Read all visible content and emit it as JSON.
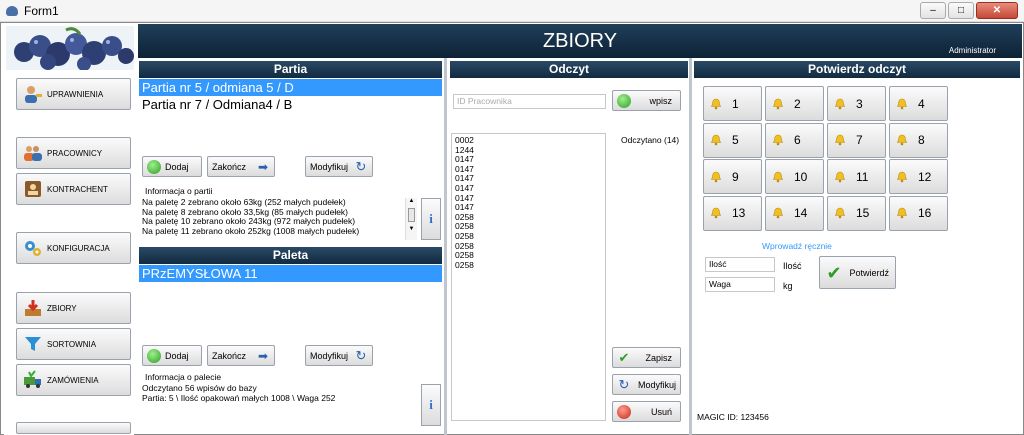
{
  "window": {
    "title": "Form1"
  },
  "header": {
    "title": "ZBIORY",
    "user": "Administrator"
  },
  "sidebar": {
    "items": [
      {
        "label": "UPRAWNIENIA",
        "icon": "user-key-icon"
      },
      {
        "label": "PRACOWNICY",
        "icon": "users-icon"
      },
      {
        "label": "KONTRACHENT",
        "icon": "contact-card-icon"
      },
      {
        "label": "KONFIGURACJA",
        "icon": "gears-icon"
      },
      {
        "label": "ZBIORY",
        "icon": "inbox-tray-icon"
      },
      {
        "label": "SORTOWNIA",
        "icon": "funnel-icon"
      },
      {
        "label": "ZAMÓWIENIA",
        "icon": "truck-icon"
      }
    ]
  },
  "partia": {
    "title": "Partia",
    "items": [
      "Partia nr 5 / odmiana 5 / D",
      "Partia nr 7 / Odmiana4 / B"
    ],
    "buttons": {
      "add": "Dodaj",
      "finish": "Zakończ",
      "modify": "Modyfikuj"
    },
    "info_label": "Informacja o partii",
    "info_lines": [
      "Na paletę 2 zebrano około 63kg (252 małych pudełek)",
      "Na paletę 8 zebrano około 33,5kg (85 małych pudełek)",
      "Na paletę 10 zebrano około 243kg (972 małych pudełek)",
      "Na paletę 11 zebrano około 252kg (1008 małych pudełek)"
    ],
    "info_button": "i"
  },
  "paleta": {
    "title": "Paleta",
    "items": [
      "PRzEMYSŁOWA 11"
    ],
    "buttons": {
      "add": "Dodaj",
      "finish": "Zakończ",
      "modify": "Modyfikuj"
    },
    "info_label": "Informacja o palecie",
    "info_lines": [
      "Odczytano 56 wpisów do bazy",
      "Partia: 5 \\ Ilość opakowań małych 1008 \\ Waga 252"
    ],
    "info_button": "i"
  },
  "odczyt": {
    "title": "Odczyt",
    "employee_placeholder": "ID Pracownika",
    "add_button": "wpisz",
    "count_label": "Odczytano (14)",
    "readings": [
      "0002",
      "1244",
      "0147",
      "0147",
      "0147",
      "0147",
      "0147",
      "0147",
      "0258",
      "0258",
      "0258",
      "0258",
      "0258",
      "0258"
    ],
    "buttons": {
      "save": "Zapisz",
      "modify": "Modyfikuj",
      "delete": "Usuń"
    }
  },
  "potwierdz": {
    "title": "Potwierdz odczyt",
    "keys": [
      "1",
      "2",
      "3",
      "4",
      "5",
      "6",
      "7",
      "8",
      "9",
      "10",
      "11",
      "12",
      "13",
      "14",
      "15",
      "16"
    ],
    "manual_label": "Wprowadź ręcznie",
    "qty_value": "Ilość",
    "qty_label": "Ilość",
    "weight_value": "Waga",
    "weight_label": "kg",
    "confirm_button": "Potwierdź",
    "magic_id": "MAGIC ID: 123456"
  },
  "colors": {
    "accent": "#3399ff",
    "header": "#122a40"
  }
}
